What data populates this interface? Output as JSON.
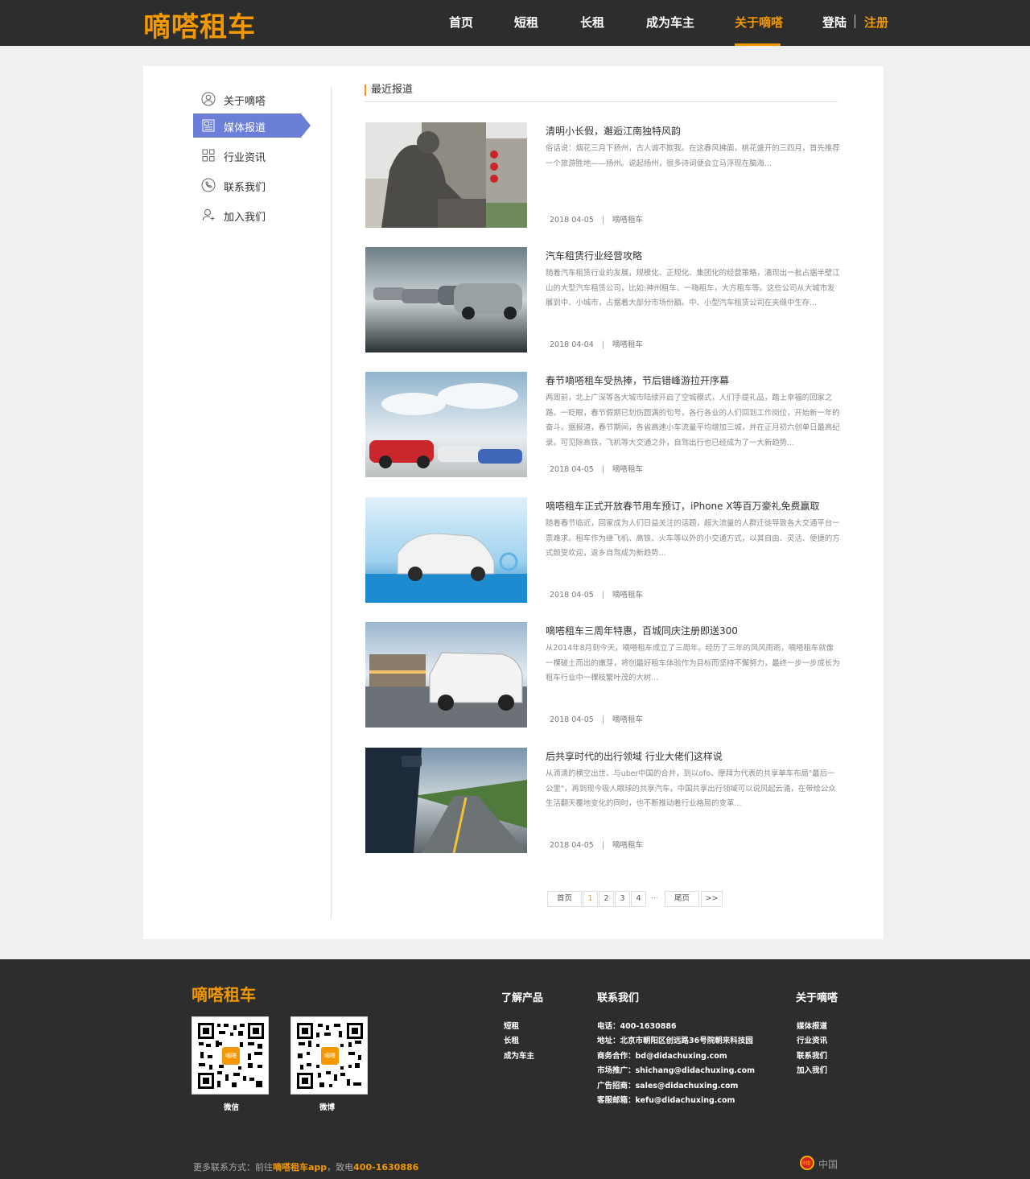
{
  "header": {
    "logo": "嘀嗒租车",
    "nav": [
      "首页",
      "短租",
      "长租",
      "成为车主",
      "关于嘀嗒"
    ],
    "active_nav": "关于嘀嗒",
    "login": "登陆",
    "register": "注册"
  },
  "sidebar": {
    "items": [
      {
        "label": "关于嘀嗒",
        "icon": "user-circle-icon"
      },
      {
        "label": "媒体报道",
        "icon": "newspaper-icon"
      },
      {
        "label": "行业资讯",
        "icon": "grid-icon"
      },
      {
        "label": "联系我们",
        "icon": "phone-icon"
      },
      {
        "label": "加入我们",
        "icon": "add-user-icon"
      }
    ],
    "active": "媒体报道"
  },
  "main": {
    "section_title": "最近报道",
    "articles": [
      {
        "title": "清明小长假，邂逅江南独特风韵",
        "summary": "俗话说：烟花三月下扬州，古人诚不欺我。在这春风拂面，桃花盛开的三四月，首先推荐一个旅游胜地——扬州。说起扬州，很多诗词便会立马浮现在脑海...",
        "date": "2018  04-05",
        "source": "嘀嗒租车"
      },
      {
        "title": "汽车租赁行业经营攻略",
        "summary": "随着汽车租赁行业的发展，规模化、正规化、集团化的经营策略，涌现出一批占据半壁江山的大型汽车租赁公司，比如:神州租车、一嗨租车，大方租车等。这些公司从大城市发展到中、小城市，占据着大部分市场份额。中、小型汽车租赁公司在夹缝中生存...",
        "date": "2018  04-04",
        "source": "嘀嗒租车"
      },
      {
        "title": "春节嘀嗒租车受热捧，节后错峰游拉开序幕",
        "summary": "两周前，北上广深等各大城市陆续开启了空城模式，人们手提礼品，踏上幸福的回家之路。一眨眼，春节假期已划伤圆满的句号，各行各业的人们回到工作岗位，开始新一年的奋斗。据报道，春节期间，各省高速小车流量平均增加三城，并在正月初六创单日最高纪录。可见除高铁，飞机等大交通之外，自驾出行也已经成为了一大新趋势...",
        "date": "2018  04-05",
        "source": "嘀嗒租车"
      },
      {
        "title": "嘀嗒租车正式开放春节用车预订，iPhone X等百万豪礼免费赢取",
        "summary": "随着春节临近，回家成为人们日益关注的话题，超大流量的人群迁徙导致各大交通平台一票难求。租车作为继飞机、高铁、火车等以外的小交通方式，以其自由、灵活、便捷的方式颇受欢迎，返乡自驾成为新趋势...",
        "date": "2018  04-05",
        "source": "嘀嗒租车"
      },
      {
        "title": "嘀嗒租车三周年特惠，百城同庆注册即送300",
        "summary": "从2014年8月到今天，嘀嗒租车成立了三周年。经历了三年的风风雨雨，嘀嗒租车就像一棵破土而出的嫩芽，将创最好租车体验作为目标而坚持不懈努力，最终一步一步成长为租车行业中一棵枝繁叶茂的大树...",
        "date": "2018  04-05",
        "source": "嘀嗒租车"
      },
      {
        "title": "后共享时代的出行领域 行业大佬们这样说",
        "summary": "从滴滴的横空出世、与uber中国的合并，到以ofo、摩拜为代表的共享单车布局\"最后一公里\"，再到现今吸人眼球的共享汽车，中国共享出行领域可以说风起云涌，在带给公众生活翻天覆地变化的同时，也不断推动着行业格局的变革...",
        "date": "2018  04-05",
        "source": "嘀嗒租车"
      }
    ],
    "pagination": {
      "first": "首页",
      "pages": [
        "1",
        "2",
        "3",
        "4"
      ],
      "current": "1",
      "ellipsis": "...",
      "last": "尾页",
      "next": ">>"
    }
  },
  "footer": {
    "logo": "嘀嗒租车",
    "qr": [
      {
        "caption": "微信",
        "center": "嘀嗒"
      },
      {
        "caption": "微博",
        "center": "嘀嗒"
      }
    ],
    "products": {
      "title": "了解产品",
      "links": [
        "短租",
        "长租",
        "成为车主"
      ]
    },
    "contact": {
      "title": "联系我们",
      "lines": [
        "电话：400-1630886",
        "地址：北京市朝阳区创远路36号院朝来科技园",
        "商务合作：bd@didachuxing.com",
        "市场推广：shichang@didachuxing.com",
        "广告招商：sales@didachuxing.com",
        "客服邮箱：kefu@didachuxing.com"
      ]
    },
    "about": {
      "title": "关于嘀嗒",
      "links": [
        "媒体报道",
        "行业资讯",
        "联系我们",
        "加入我们"
      ]
    },
    "bottom": {
      "prefix": "更多联系方式：前往",
      "app": "嘀嗒租车app",
      "mid": "，致电",
      "phone": "400-1630886"
    },
    "region_badge": "中国",
    "region": "中国"
  },
  "colors": {
    "accent": "#f39800",
    "header_bg": "#2d2d2d",
    "sidebar_active": "#6c7fd8"
  }
}
